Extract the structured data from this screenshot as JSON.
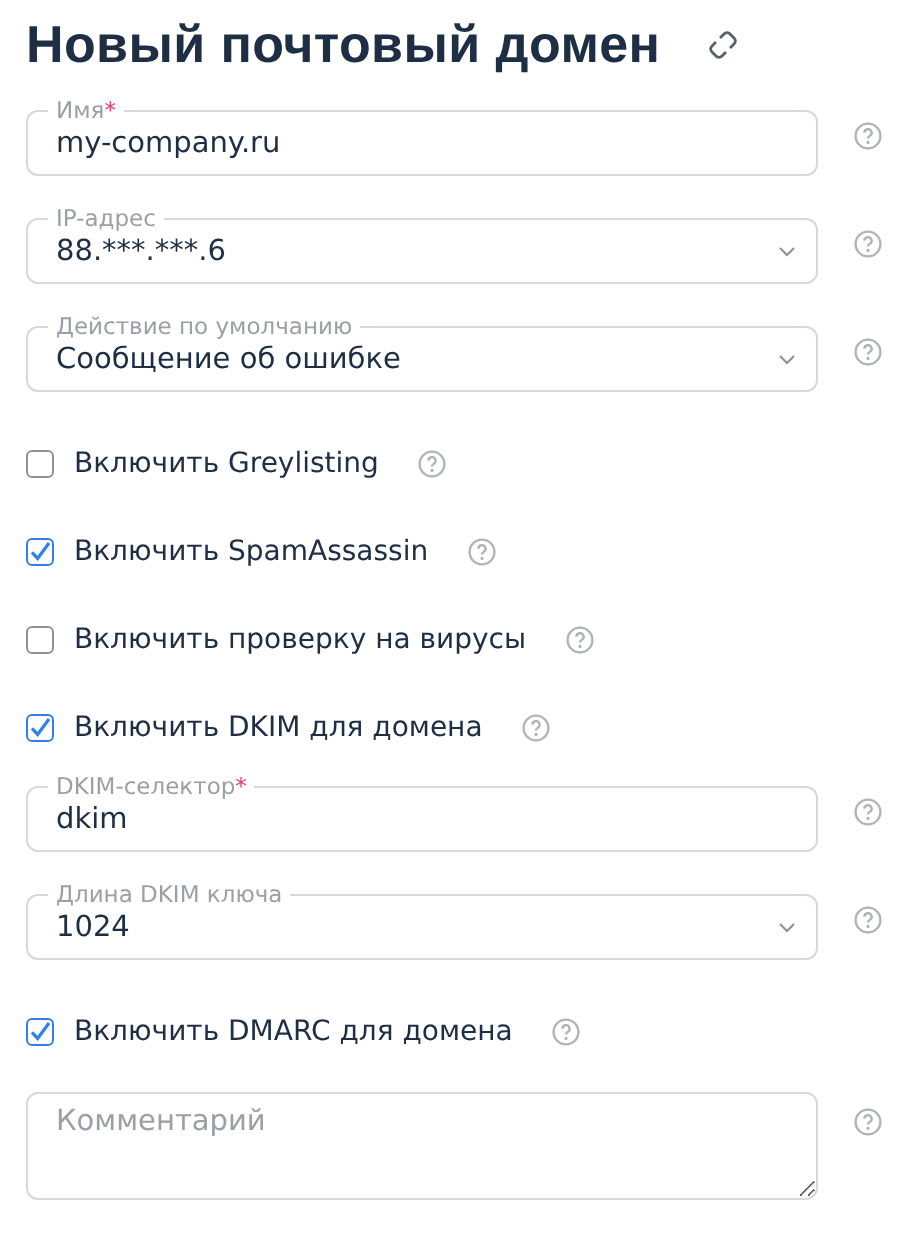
{
  "title": "Новый почтовый домен",
  "fields": [
    {
      "kind": "text",
      "label": "Имя",
      "required_mark": "*",
      "value": "my-company.ru"
    },
    {
      "kind": "select",
      "label": "IP-адрес",
      "value": "88.***.***.6"
    },
    {
      "kind": "select",
      "label": "Действие по умолчанию",
      "value": "Сообщение об ошибке"
    },
    {
      "kind": "checkbox",
      "label": "Включить Greylisting",
      "checked": false
    },
    {
      "kind": "checkbox",
      "label": "Включить SpamAssassin",
      "checked": true
    },
    {
      "kind": "checkbox",
      "label": "Включить проверку на вирусы",
      "checked": false
    },
    {
      "kind": "checkbox",
      "label": "Включить DKIM для домена",
      "checked": true
    },
    {
      "kind": "text",
      "label": "DKIM-селектор",
      "required_mark": "*",
      "value": "dkim"
    },
    {
      "kind": "select",
      "label": "Длина DKIM ключа",
      "value": "1024"
    },
    {
      "kind": "checkbox",
      "label": "Включить DMARC для домена",
      "checked": true
    },
    {
      "kind": "textarea",
      "placeholder": "Комментарий"
    }
  ]
}
